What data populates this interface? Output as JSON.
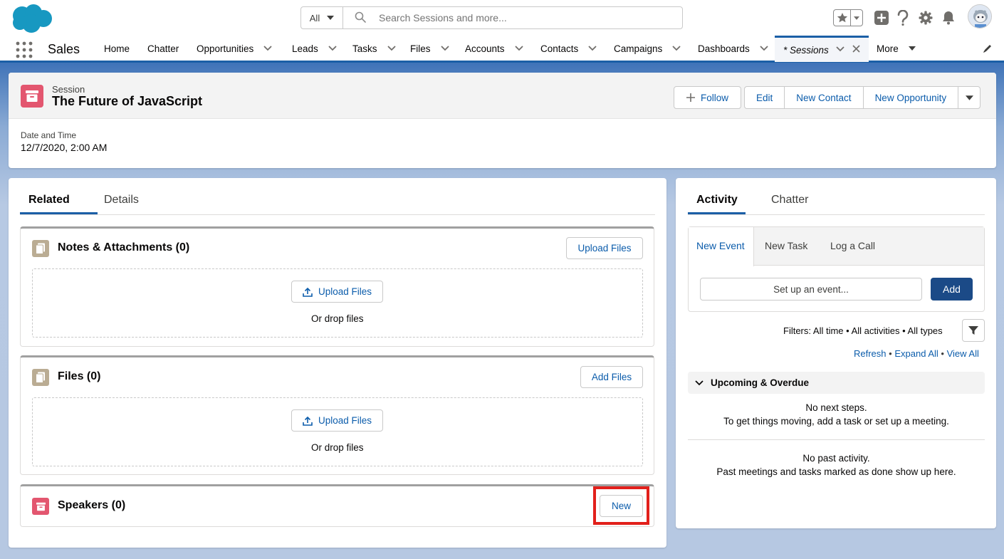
{
  "header": {
    "search_scope": "All",
    "search_placeholder": "Search Sessions and more..."
  },
  "nav": {
    "app_name": "Sales",
    "items": [
      "Home",
      "Chatter",
      "Opportunities",
      "Leads",
      "Tasks",
      "Files",
      "Accounts",
      "Contacts",
      "Campaigns",
      "Dashboards"
    ],
    "active_tab": "* Sessions",
    "more": "More"
  },
  "record": {
    "object_type": "Session",
    "title": "The Future of JavaScript",
    "actions": {
      "follow": "Follow",
      "edit": "Edit",
      "new_contact": "New Contact",
      "new_opportunity": "New Opportunity"
    },
    "highlight_label": "Date and Time",
    "highlight_value": "12/7/2020, 2:00 AM"
  },
  "left": {
    "tabs": [
      "Related",
      "Details"
    ],
    "notes": {
      "title": "Notes & Attachments (0)",
      "header_button": "Upload Files",
      "upload_button": "Upload Files",
      "drop_text": "Or drop files"
    },
    "files": {
      "title": "Files (0)",
      "header_button": "Add Files",
      "upload_button": "Upload Files",
      "drop_text": "Or drop files"
    },
    "speakers": {
      "title": "Speakers (0)",
      "header_button": "New"
    }
  },
  "right": {
    "tabs": [
      "Activity",
      "Chatter"
    ],
    "composer_tabs": [
      "New Event",
      "New Task",
      "Log a Call"
    ],
    "event_placeholder": "Set up an event...",
    "add_button": "Add",
    "filters": "Filters: All time • All activities • All types",
    "links": [
      "Refresh",
      "Expand All",
      "View All"
    ],
    "upcoming_title": "Upcoming & Overdue",
    "no_next_steps": "No next steps.",
    "no_next_steps_hint": "To get things moving, add a task or set up a meeting.",
    "no_past": "No past activity.",
    "no_past_hint": "Past meetings and tasks marked as done show up here."
  },
  "colors": {
    "brand": "#1b5fa6",
    "link": "#0b5cab",
    "object_icon": "#e3566f",
    "highlight": "#e2201b"
  }
}
